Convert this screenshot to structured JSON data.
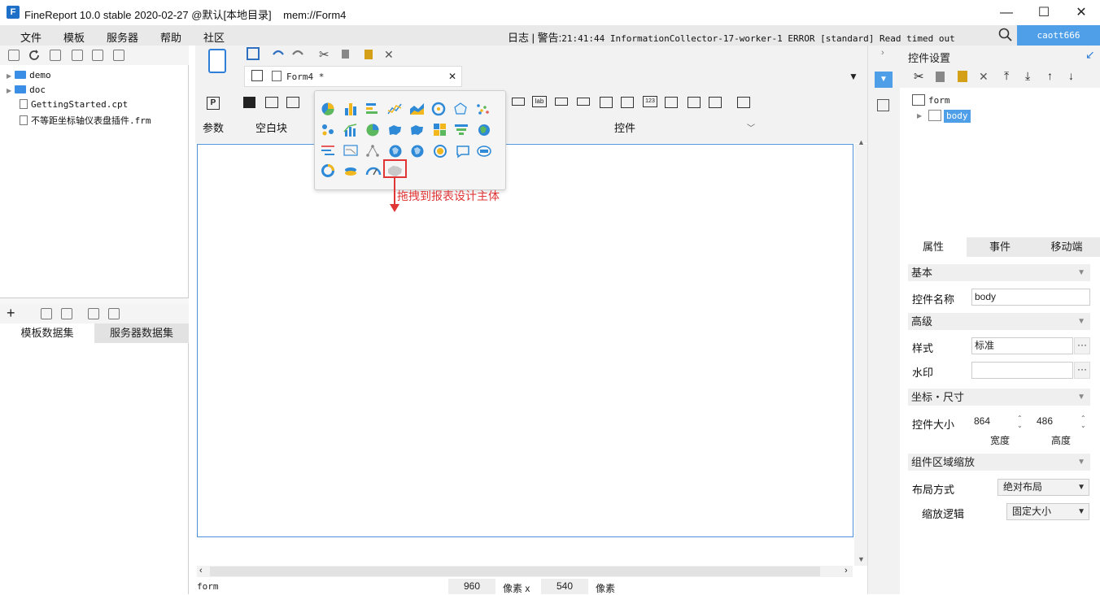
{
  "window": {
    "title": "FineReport 10.0 stable 2020-02-27 @默认[本地目录]    mem://Form4",
    "minimize": "—",
    "maximize": "☐",
    "close": "✕"
  },
  "menu": {
    "items": [
      "文件",
      "模板",
      "服务器",
      "帮助",
      "社区"
    ],
    "log_label": "日志",
    "warning_prefix": "| 警告:",
    "warning_text": "21:41:44 InformationCollector-17-worker-1 ERROR [standard] Read timed out",
    "user": "caott666"
  },
  "file_tree": {
    "items": [
      {
        "type": "folder",
        "name": "demo"
      },
      {
        "type": "folder",
        "name": "doc"
      },
      {
        "type": "file",
        "name": "GettingStarted.cpt"
      },
      {
        "type": "file",
        "name": "不等距坐标轴仪表盘插件.frm"
      }
    ]
  },
  "dataset": {
    "tab_template": "模板数据集",
    "tab_server": "服务器数据集"
  },
  "editor": {
    "tab_name": "Form4 *",
    "group_param": "参数",
    "group_blank": "空白块",
    "group_widget": "控件",
    "param_icon": "P",
    "lab_icon": "lab",
    "num_icon": "123"
  },
  "annotation": {
    "text": "拖拽到报表设计主体"
  },
  "status": {
    "element": "form",
    "width": "960",
    "unit1": "像素 x",
    "height": "540",
    "unit2": "像素"
  },
  "right_panel": {
    "title": "控件设置",
    "tree_root": "form",
    "tree_child": "body",
    "tabs": [
      "属性",
      "事件",
      "移动端"
    ],
    "sec_basic": "基本",
    "lbl_name": "控件名称",
    "val_name": "body",
    "sec_advanced": "高级",
    "lbl_style": "样式",
    "val_style": "标准",
    "lbl_watermark": "水印",
    "sec_coords": "坐标・尺寸",
    "lbl_size": "控件大小",
    "val_width": "864",
    "val_height": "486",
    "lbl_width": "宽度",
    "lbl_height": "高度",
    "sec_zoom": "组件区域缩放",
    "lbl_layout": "布局方式",
    "val_layout": "绝对布局",
    "lbl_scale": "缩放逻辑",
    "val_scale": "固定大小",
    "ellipsis": "···"
  },
  "colors": {
    "accent": "#4f9fe8",
    "highlight_red": "#e03636",
    "canvas_border": "#4f8ed8"
  }
}
